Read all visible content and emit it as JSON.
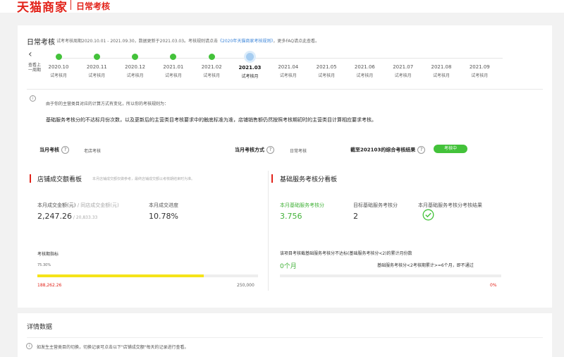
{
  "header": {
    "logo": "天猫商家",
    "app_title": "日常考核"
  },
  "top": {
    "title": "日常考核",
    "note_prefix": "试考考核周期2020.10.01 - 2021.09.30，数据更新于2021.03.03。考核规则请点击",
    "note_link": "《2020年天猫商家考核规则》",
    "note_suffix": "，更多FAQ请点此查看。"
  },
  "timeline": {
    "back_label": "查看上一周期",
    "back_arrow": "‹",
    "items": [
      {
        "month": "2020.10",
        "type": "试考核月",
        "state": "done"
      },
      {
        "month": "2020.11",
        "type": "试考核月",
        "state": "done"
      },
      {
        "month": "2020.12",
        "type": "试考核月",
        "state": "done"
      },
      {
        "month": "2021.01",
        "type": "试考核月",
        "state": "done"
      },
      {
        "month": "2021.02",
        "type": "试考核月",
        "state": "done"
      },
      {
        "month": "2021.03",
        "type": "试考核月",
        "state": "current"
      },
      {
        "month": "2021.04",
        "type": "试考核月",
        "state": "future"
      },
      {
        "month": "2021.05",
        "type": "试考核月",
        "state": "future"
      },
      {
        "month": "2021.06",
        "type": "试考核月",
        "state": "future"
      },
      {
        "month": "2021.07",
        "type": "试考核月",
        "state": "future"
      },
      {
        "month": "2021.08",
        "type": "试考核月",
        "state": "future"
      },
      {
        "month": "2021.09",
        "type": "试考核月",
        "state": "future"
      }
    ]
  },
  "notice": {
    "icon": "i",
    "line1": "由于你的主营类目对应的计算方式有变化，所以你的考核规则为：",
    "line2": "基础服务考核分的不达标月份次数，以及更新后的主营类目考核要求中的触底标准为准，店铺销售额仍然按照考核期初时的主营类目计算相应要求考核。"
  },
  "summary": {
    "month_assess_label": "当月考核",
    "month_assess_value": "老店考核",
    "month_method_label": "当月考核方式",
    "month_method_value": "日常考核",
    "result_label": "截至202103的综合考核结果",
    "result_badge": "考核中",
    "help_icon": "?"
  },
  "sales": {
    "title": "店铺成交额看板",
    "subtitle": "本月店铺成交额仅做参考，最终店铺成交额以考核期结束时为准。",
    "metric1_label": "本月成交金额(元)",
    "metric1_label_muted": " / 同店成交金额(元)",
    "metric1_value": "2,247.26",
    "metric1_sub": " / 20,833.33",
    "metric2_label": "本月成交进度",
    "metric2_value": "10.78%",
    "progress_label": "考核期指标",
    "progress_pct": "75.30%",
    "progress_fraction": 0.753,
    "current_amount": "188,262.26",
    "target_amount": "250,000"
  },
  "service": {
    "title": "基础服务考核分看板",
    "metric1_label": "本月基础服务考核分",
    "metric1_value": "3.756",
    "metric2_label": "目标基础服务考核分",
    "metric2_value": "2",
    "metric3_label": "本月基础服务考核分考核结果",
    "rule_text": "该项目考核截基础服务考核分不达标(基础服务考核分<2)的累计月份数",
    "months_value": "0个月",
    "rule_condition": "基础服务考核分<2考核期累计>=6个月，即不通过",
    "rule_fraction": 0,
    "rule_pct": "0%"
  },
  "details": {
    "title": "详情数据",
    "note": "如发生主营类目的切换，切换记录可点击以下\"店铺成交额\"每天的记录进行查看。"
  },
  "colors": {
    "brand": "#e2231a",
    "success": "#43c23a",
    "link": "#3e86d9",
    "progress": "#f5e31a"
  }
}
